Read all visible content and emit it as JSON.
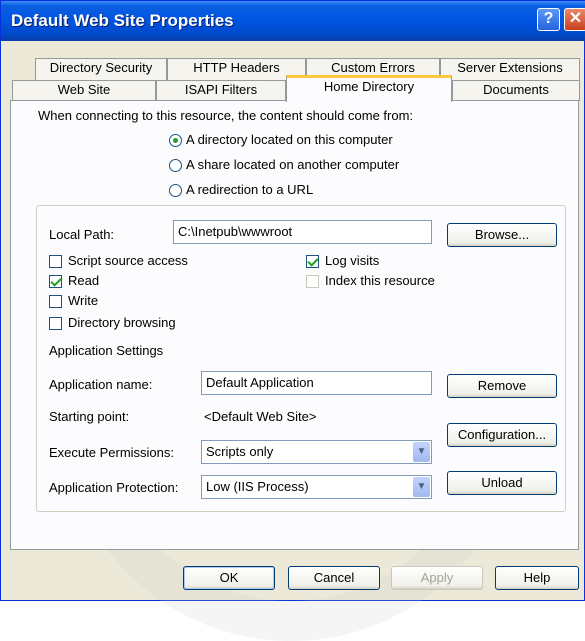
{
  "window": {
    "title": "Default Web Site Properties",
    "help_glyph": "?",
    "close_glyph": "✕"
  },
  "tabs_row1": [
    "Directory Security",
    "HTTP Headers",
    "Custom Errors",
    "Server Extensions"
  ],
  "tabs_row2": [
    "Web Site",
    "ISAPI Filters",
    "Home Directory",
    "Documents"
  ],
  "selected_tab": "Home Directory",
  "content": {
    "prompt": "When connecting to this resource, the content should come from:",
    "options": [
      "A directory located on this computer",
      "A share located on another computer",
      "A redirection to a URL"
    ],
    "selected_option": "A directory located on this computer"
  },
  "path": {
    "label": "Local Path:",
    "value": "C:\\Inetpub\\wwwroot",
    "browse": "Browse..."
  },
  "checks": {
    "script_source": {
      "label": "Script source access",
      "checked": false
    },
    "read": {
      "label": "Read",
      "checked": true
    },
    "write": {
      "label": "Write",
      "checked": false
    },
    "dir_browsing": {
      "label": "Directory browsing",
      "checked": false
    },
    "log_visits": {
      "label": "Log visits",
      "checked": true
    },
    "index": {
      "label": "Index this resource",
      "checked": false
    }
  },
  "app": {
    "section": "Application Settings",
    "name_label": "Application name:",
    "name_value": "Default Application",
    "remove": "Remove",
    "start_label": "Starting point:",
    "start_value": "<Default Web Site>",
    "config": "Configuration...",
    "exec_label": "Execute Permissions:",
    "exec_value": "Scripts only",
    "prot_label": "Application Protection:",
    "prot_value": "Low (IIS Process)",
    "unload": "Unload"
  },
  "buttons": {
    "ok": "OK",
    "cancel": "Cancel",
    "apply": "Apply",
    "help": "Help"
  }
}
